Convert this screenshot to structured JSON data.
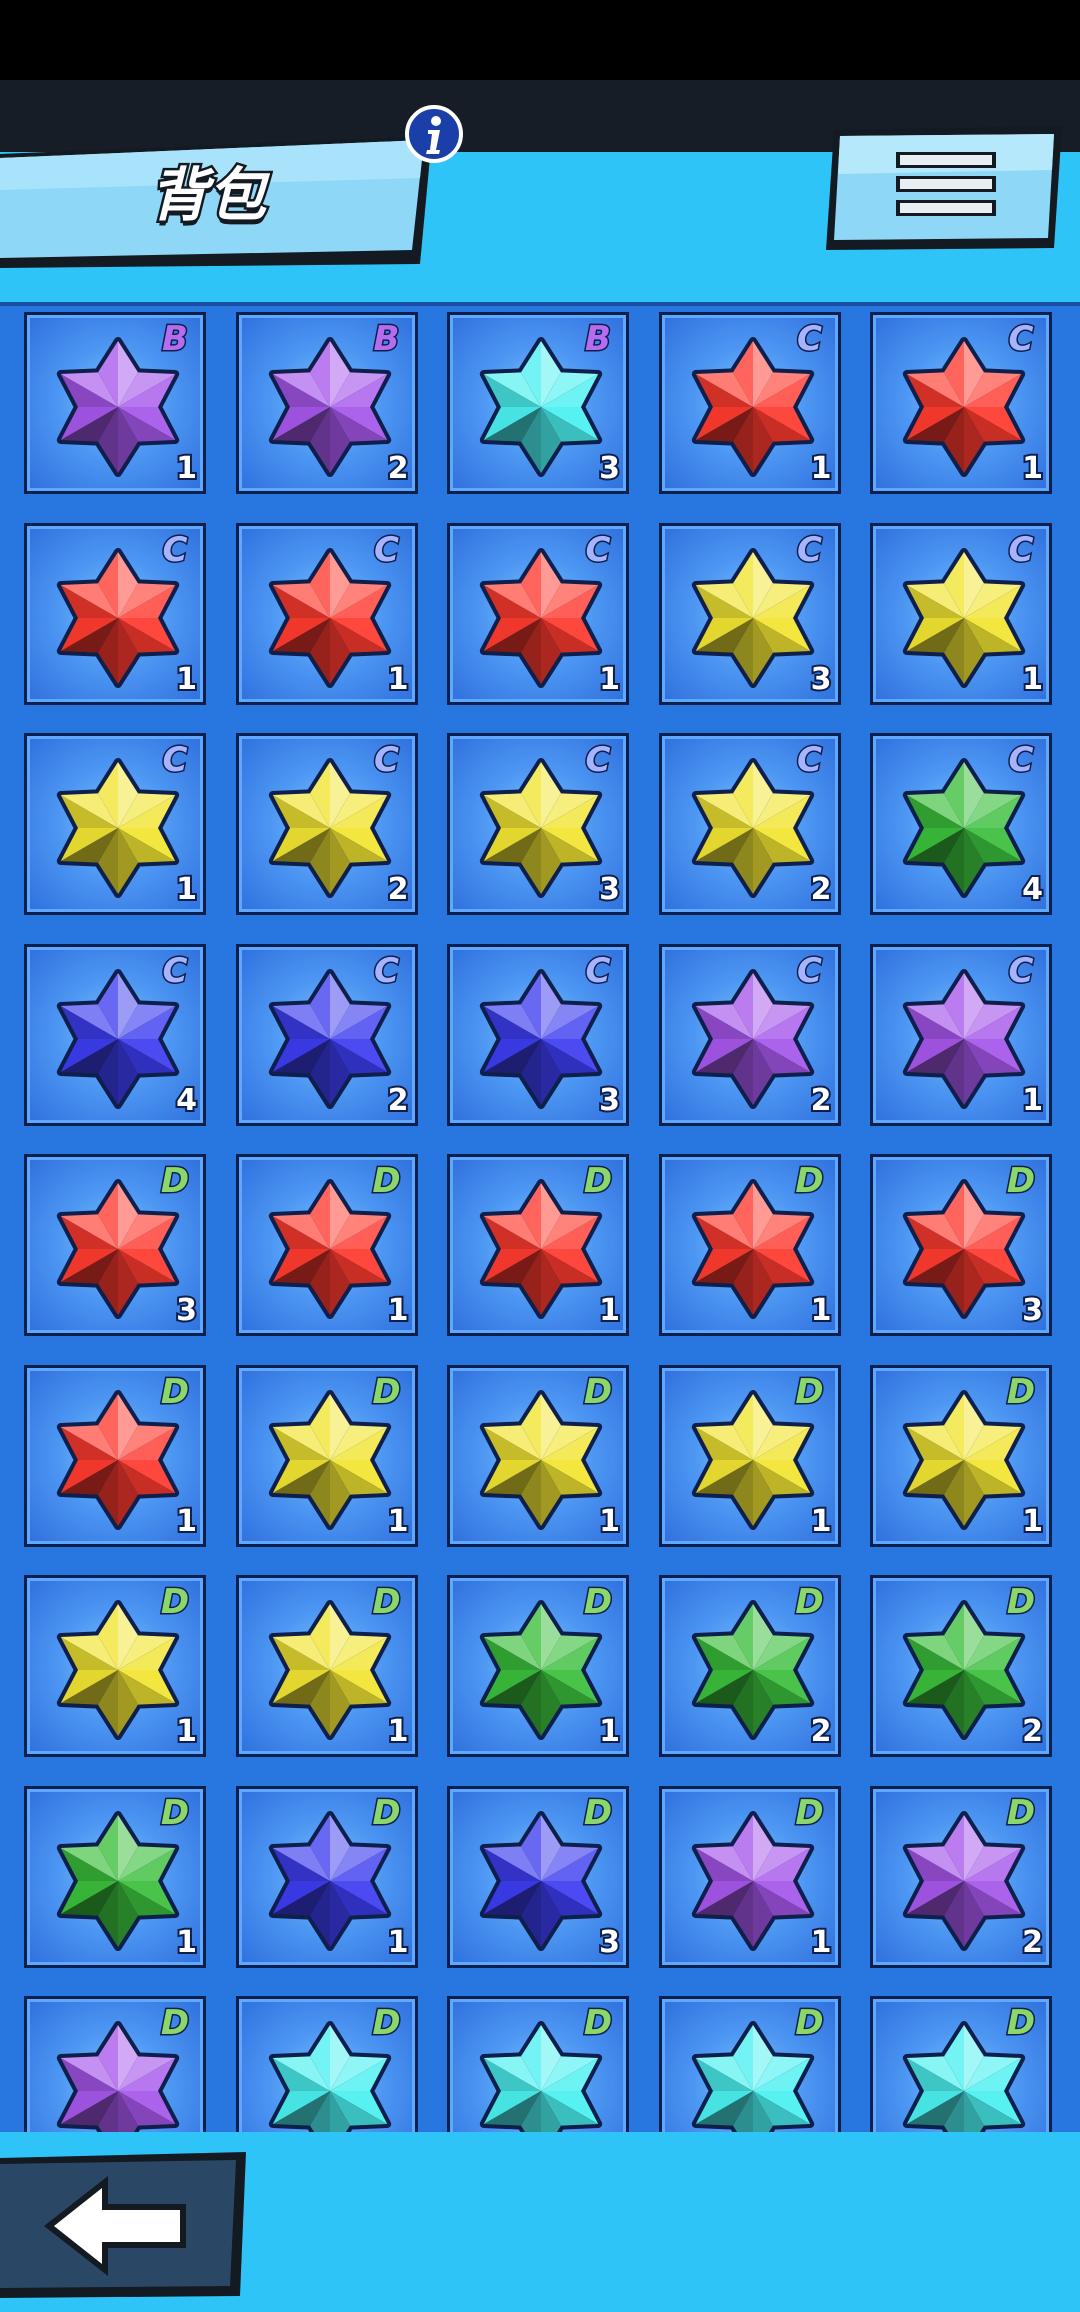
{
  "header": {
    "title": "背包",
    "info_icon": "info-icon",
    "menu_icon": "hamburger-menu-icon"
  },
  "footer": {
    "back_icon": "back-arrow-icon"
  },
  "colors": {
    "purple": "#a657ea",
    "cyan": "#4bf0f0",
    "red": "#ff3a2e",
    "yellow": "#f1e431",
    "green": "#3bbf3b",
    "blue": "#3d3df0"
  },
  "inventory": [
    {
      "color": "purple",
      "rank": "B",
      "count": "1"
    },
    {
      "color": "purple",
      "rank": "B",
      "count": "2"
    },
    {
      "color": "cyan",
      "rank": "B",
      "count": "3"
    },
    {
      "color": "red",
      "rank": "C",
      "count": "1"
    },
    {
      "color": "red",
      "rank": "C",
      "count": "1"
    },
    {
      "color": "red",
      "rank": "C",
      "count": "1"
    },
    {
      "color": "red",
      "rank": "C",
      "count": "1"
    },
    {
      "color": "red",
      "rank": "C",
      "count": "1"
    },
    {
      "color": "yellow",
      "rank": "C",
      "count": "3"
    },
    {
      "color": "yellow",
      "rank": "C",
      "count": "1"
    },
    {
      "color": "yellow",
      "rank": "C",
      "count": "1"
    },
    {
      "color": "yellow",
      "rank": "C",
      "count": "2"
    },
    {
      "color": "yellow",
      "rank": "C",
      "count": "3"
    },
    {
      "color": "yellow",
      "rank": "C",
      "count": "2"
    },
    {
      "color": "green",
      "rank": "C",
      "count": "4"
    },
    {
      "color": "blue",
      "rank": "C",
      "count": "4"
    },
    {
      "color": "blue",
      "rank": "C",
      "count": "2"
    },
    {
      "color": "blue",
      "rank": "C",
      "count": "3"
    },
    {
      "color": "purple",
      "rank": "C",
      "count": "2"
    },
    {
      "color": "purple",
      "rank": "C",
      "count": "1"
    },
    {
      "color": "red",
      "rank": "D",
      "count": "3"
    },
    {
      "color": "red",
      "rank": "D",
      "count": "1"
    },
    {
      "color": "red",
      "rank": "D",
      "count": "1"
    },
    {
      "color": "red",
      "rank": "D",
      "count": "1"
    },
    {
      "color": "red",
      "rank": "D",
      "count": "3"
    },
    {
      "color": "red",
      "rank": "D",
      "count": "1"
    },
    {
      "color": "yellow",
      "rank": "D",
      "count": "1"
    },
    {
      "color": "yellow",
      "rank": "D",
      "count": "1"
    },
    {
      "color": "yellow",
      "rank": "D",
      "count": "1"
    },
    {
      "color": "yellow",
      "rank": "D",
      "count": "1"
    },
    {
      "color": "yellow",
      "rank": "D",
      "count": "1"
    },
    {
      "color": "yellow",
      "rank": "D",
      "count": "1"
    },
    {
      "color": "green",
      "rank": "D",
      "count": "1"
    },
    {
      "color": "green",
      "rank": "D",
      "count": "2"
    },
    {
      "color": "green",
      "rank": "D",
      "count": "2"
    },
    {
      "color": "green",
      "rank": "D",
      "count": "1"
    },
    {
      "color": "blue",
      "rank": "D",
      "count": "1"
    },
    {
      "color": "blue",
      "rank": "D",
      "count": "3"
    },
    {
      "color": "purple",
      "rank": "D",
      "count": "1"
    },
    {
      "color": "purple",
      "rank": "D",
      "count": "2"
    },
    {
      "color": "purple",
      "rank": "D",
      "count": ""
    },
    {
      "color": "cyan",
      "rank": "D",
      "count": ""
    },
    {
      "color": "cyan",
      "rank": "D",
      "count": ""
    },
    {
      "color": "cyan",
      "rank": "D",
      "count": ""
    },
    {
      "color": "cyan",
      "rank": "D",
      "count": ""
    }
  ]
}
